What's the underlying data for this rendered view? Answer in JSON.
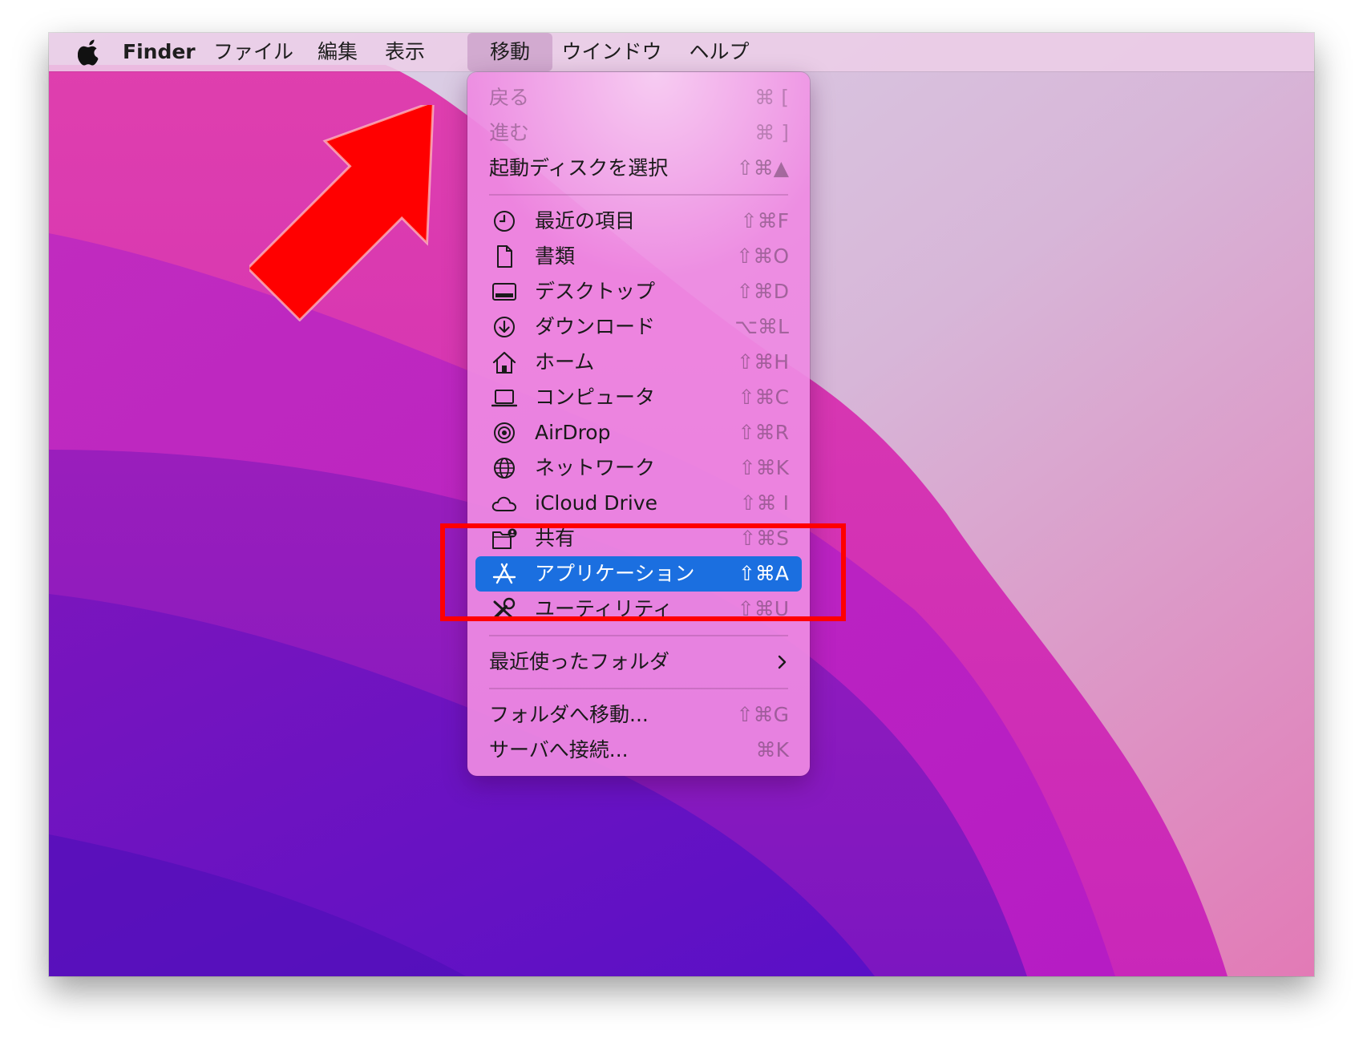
{
  "menubar": {
    "apple_icon": "apple-logo-icon",
    "items": [
      {
        "label": "Finder",
        "bold": true
      },
      {
        "label": "ファイル"
      },
      {
        "label": "編集"
      },
      {
        "label": "表示"
      },
      {
        "label": "移動",
        "active": true
      },
      {
        "label": "ウインドウ"
      },
      {
        "label": "ヘルプ"
      }
    ]
  },
  "go_menu": {
    "items": [
      {
        "label": "戻る",
        "shortcut": "⌘ [",
        "disabled": true
      },
      {
        "label": "進む",
        "shortcut": "⌘ ]",
        "disabled": true
      },
      {
        "label": "起動ディスクを選択",
        "shortcut": "⇧⌘▲"
      },
      {
        "label": "最近の項目",
        "shortcut": "⇧⌘F",
        "icon": "clock-icon"
      },
      {
        "label": "書類",
        "shortcut": "⇧⌘O",
        "icon": "document-icon"
      },
      {
        "label": "デスクトップ",
        "shortcut": "⇧⌘D",
        "icon": "desktop-icon"
      },
      {
        "label": "ダウンロード",
        "shortcut": "⌥⌘L",
        "icon": "download-icon"
      },
      {
        "label": "ホーム",
        "shortcut": "⇧⌘H",
        "icon": "home-icon"
      },
      {
        "label": "コンピュータ",
        "shortcut": "⇧⌘C",
        "icon": "laptop-icon"
      },
      {
        "label": "AirDrop",
        "shortcut": "⇧⌘R",
        "icon": "airdrop-icon"
      },
      {
        "label": "ネットワーク",
        "shortcut": "⇧⌘K",
        "icon": "globe-icon"
      },
      {
        "label": "iCloud Drive",
        "shortcut": "⇧⌘ I",
        "icon": "cloud-icon"
      },
      {
        "label": "共有",
        "shortcut": "⇧⌘S",
        "icon": "shared-folder-icon"
      },
      {
        "label": "アプリケーション",
        "shortcut": "⇧⌘A",
        "icon": "app-store-icon",
        "selected": true
      },
      {
        "label": "ユーティリティ",
        "shortcut": "⇧⌘U",
        "icon": "utilities-icon"
      },
      {
        "label": "最近使ったフォルダ",
        "submenu": true
      },
      {
        "label": "フォルダへ移動...",
        "shortcut": "⇧⌘G"
      },
      {
        "label": "サーバへ接続...",
        "shortcut": "⌘K"
      }
    ]
  },
  "annotation": {
    "highlight_color": "#ff0000",
    "arrow_color": "#ff0000",
    "selection_color": "#1b6fe0"
  }
}
